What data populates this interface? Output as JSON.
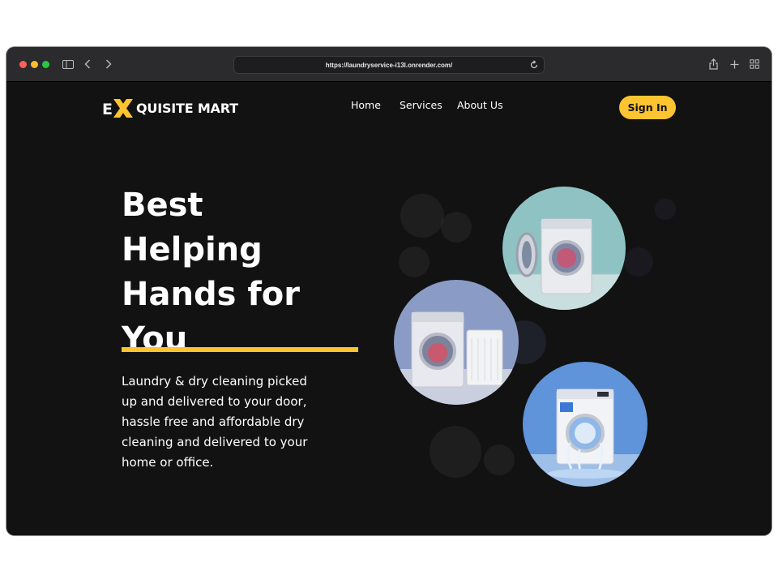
{
  "browser": {
    "url": "https://laundryservice-i13l.onrender.com/"
  },
  "site": {
    "logo": {
      "mark": "X",
      "prefix": "E",
      "suffix": "QUISITE MART"
    },
    "nav": [
      "Home",
      "Services",
      "About Us"
    ],
    "signin_label": "Sign In",
    "accent": "#fbc430"
  },
  "hero": {
    "title_lines": [
      "Best",
      "Helping",
      "Hands for",
      "You"
    ],
    "description": "Laundry & dry cleaning picked up and delivered to your door, hassle free and affordable dry cleaning and delivered to your home or office."
  },
  "images": [
    {
      "name": "washer-open-door-photo",
      "bg": "#8fc3c3"
    },
    {
      "name": "washer-with-hamper-photo",
      "bg": "#8a9bc6"
    },
    {
      "name": "washer-splash-photo",
      "bg": "#5f93da"
    }
  ]
}
